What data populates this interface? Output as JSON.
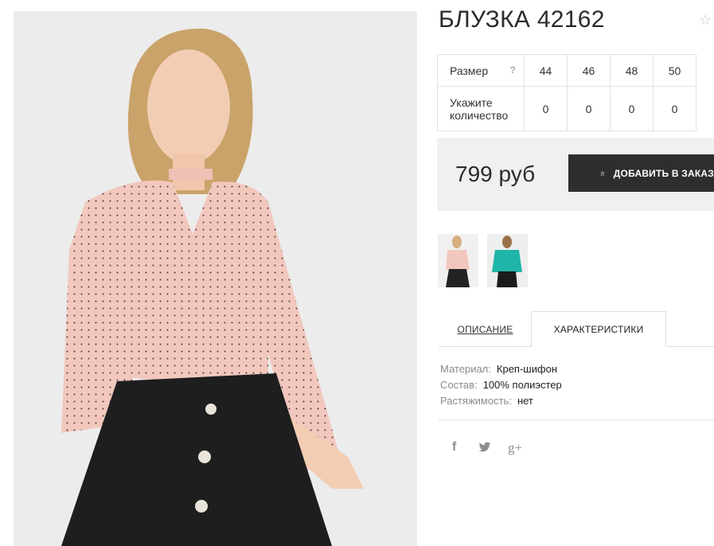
{
  "product": {
    "title": "БЛУЗКА 42162",
    "favorite_icon": "star-outline-icon"
  },
  "sizes": {
    "row_label": "Размер",
    "help_glyph": "?",
    "values": [
      "44",
      "46",
      "48",
      "50"
    ],
    "qty_label_line1": "Укажите",
    "qty_label_line2": "количество",
    "quantities": [
      "0",
      "0",
      "0",
      "0"
    ]
  },
  "purchase": {
    "price": "799 руб",
    "add_to_cart_label": "ДОБАВИТЬ В ЗАКАЗ",
    "bag_icon": "shopping-bag-icon",
    "button_color": "#2e2e2e"
  },
  "thumbnails": [
    {
      "variant": "pink-blouse"
    },
    {
      "variant": "turquoise-blouse"
    }
  ],
  "tabs": {
    "description": "ОПИСАНИЕ",
    "characteristics": "ХАРАКТЕРИСТИКИ",
    "active": "characteristics"
  },
  "characteristics": [
    {
      "key": "Материал:",
      "value": "Креп-шифон"
    },
    {
      "key": "Состав:",
      "value": "100% полиэстер"
    },
    {
      "key": "Растяжимость:",
      "value": "нет"
    }
  ],
  "social": {
    "facebook": "f",
    "twitter": "🐦",
    "google_plus": "g+"
  }
}
